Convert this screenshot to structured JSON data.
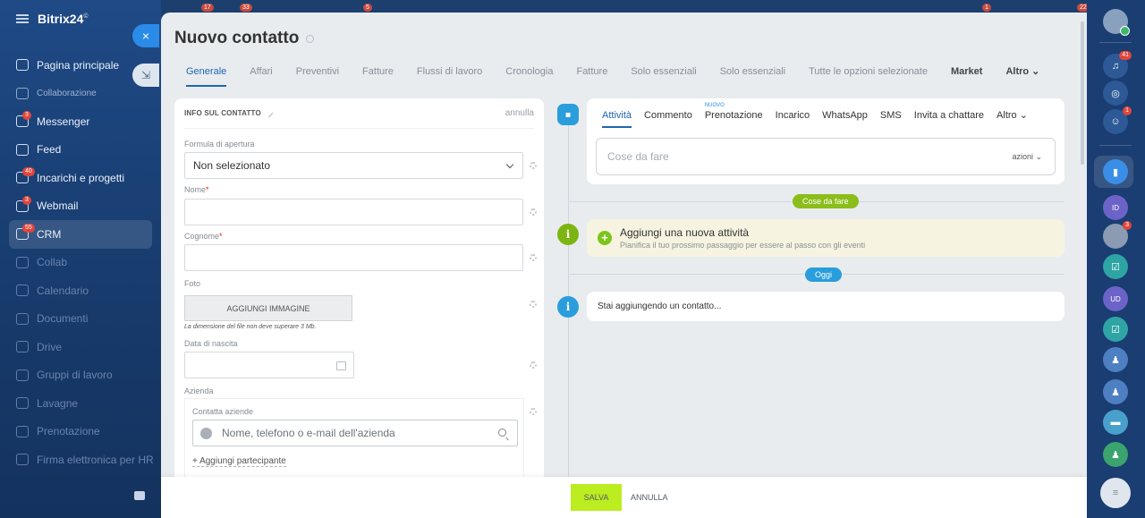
{
  "sidebar": {
    "brand": "Bitrix24",
    "brand_mark": "©",
    "items": [
      {
        "label": "Pagina principale",
        "badge": ""
      },
      {
        "label": "Collaborazione",
        "badge": ""
      },
      {
        "label": "Messenger",
        "badge": "3"
      },
      {
        "label": "Feed",
        "badge": ""
      },
      {
        "label": "Incarichi e progetti",
        "badge": "40"
      },
      {
        "label": "Webmail",
        "badge": "3"
      },
      {
        "label": "CRM",
        "badge": "55"
      },
      {
        "label": "Collab",
        "badge": ""
      },
      {
        "label": "Calendario",
        "badge": ""
      },
      {
        "label": "Documenti",
        "badge": ""
      },
      {
        "label": "Drive",
        "badge": ""
      },
      {
        "label": "Gruppi di lavoro",
        "badge": ""
      },
      {
        "label": "Lavagne",
        "badge": ""
      },
      {
        "label": "Prenotazione",
        "badge": ""
      },
      {
        "label": "Firma elettronica per HR",
        "badge": ""
      }
    ]
  },
  "top_badges": [
    "17",
    "33",
    "5",
    "1",
    "22"
  ],
  "slider": {
    "close_label": "×",
    "collapse_label": "⇲"
  },
  "page": {
    "title": "Nuovo contatto",
    "tabs": [
      "Generale",
      "Affari",
      "Preventivi",
      "Fatture",
      "Flussi di lavoro",
      "Cronologia",
      "Fatture",
      "Solo essenziali",
      "Solo essenziali",
      "Tutte le opzioni selezionate",
      "Market",
      "Altro ⌄"
    ]
  },
  "form": {
    "section_title": "INFO SUL CONTATTO",
    "cancel_link": "annulla",
    "salutation_label": "Formula di apertura",
    "salutation_value": "Non selezionato",
    "name_label": "Nome",
    "surname_label": "Cognome",
    "required_mark": "*",
    "photo_label": "Foto",
    "add_image_button": "AGGIUNGI IMMAGINE",
    "image_hint": "La dimensione del file non deve superare 3 Mb.",
    "birthdate_label": "Data di nascita",
    "company_label": "Azienda",
    "company_sub_label": "Contatta aziende",
    "company_placeholder": "Nome, telefono o e-mail dell'azienda",
    "add_participant": "+ Aggiungi partecipante"
  },
  "activity": {
    "tabs": [
      "Attività",
      "Commento",
      "Prenotazione",
      "Incarico",
      "WhatsApp",
      "SMS",
      "Invita a chattare",
      "Altro ⌄"
    ],
    "new_badge": "NUOVO",
    "todo_placeholder": "Cose da fare",
    "todo_actions": "azioni ⌄"
  },
  "timeline": {
    "todo_pill": "Cose da fare",
    "add_title": "Aggiungi una nuova attività",
    "add_subtitle": "Pianifica il tuo prossimo passaggio per essere al passo con gli eventi",
    "today_pill": "Oggi",
    "info_text": "Stai aggiungendo un contatto..."
  },
  "footer": {
    "save": "SALVA",
    "cancel": "ANNULLA"
  },
  "rightbar": {
    "badges": [
      "41",
      "1",
      "3"
    ]
  },
  "colors": {
    "accent_blue": "#2066b0",
    "save_green": "#bbed21",
    "todo_pill": "#8bbd1b",
    "today_pill": "#2a9ddc",
    "timeline_icon_green": "#7cb511",
    "timeline_icon_blue": "#2a9ddc"
  }
}
